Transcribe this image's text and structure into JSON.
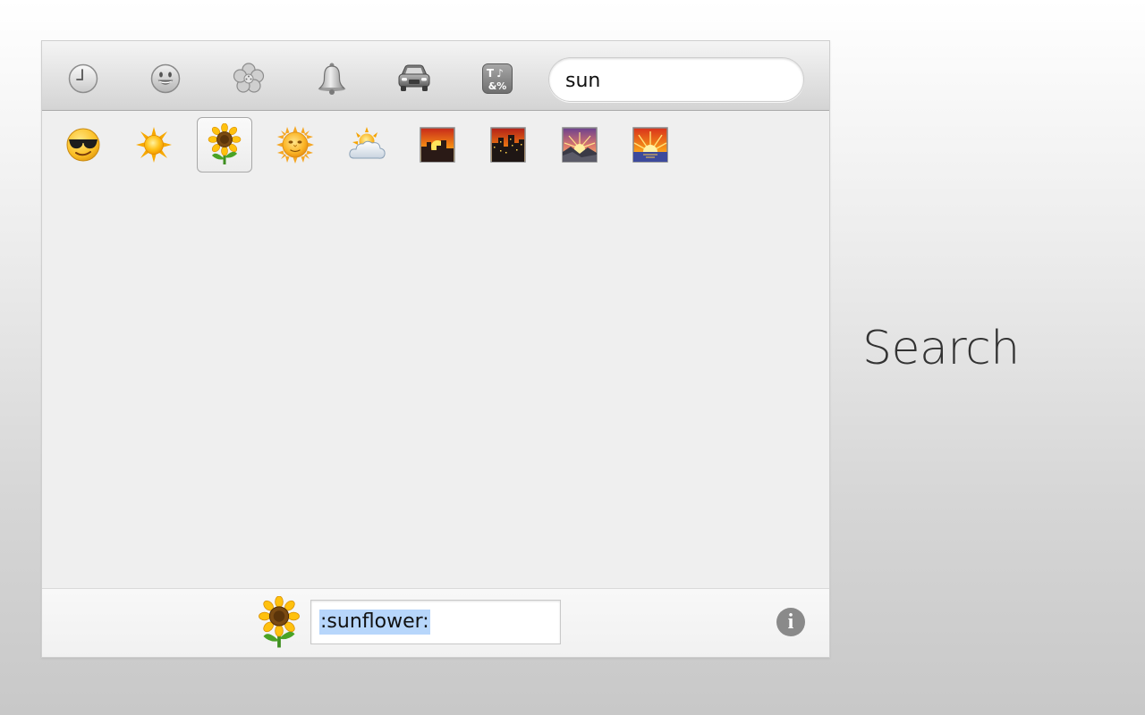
{
  "toolbar": {
    "tabs": [
      {
        "icon": "clock-icon",
        "name": "recent"
      },
      {
        "icon": "smiley-icon",
        "name": "people"
      },
      {
        "icon": "flower-icon",
        "name": "nature"
      },
      {
        "icon": "bell-icon",
        "name": "objects"
      },
      {
        "icon": "car-icon",
        "name": "places"
      },
      {
        "icon": "symbols-icon",
        "name": "symbols"
      }
    ],
    "search_value": "sun"
  },
  "results": [
    {
      "name": "sunglasses-face-emoji"
    },
    {
      "name": "sun-emoji"
    },
    {
      "name": "sunflower-emoji",
      "selected": true
    },
    {
      "name": "sun-face-emoji"
    },
    {
      "name": "sun-behind-cloud-emoji"
    },
    {
      "name": "city-sunset-emoji"
    },
    {
      "name": "city-dusk-emoji"
    },
    {
      "name": "sunrise-over-mountains-emoji"
    },
    {
      "name": "sunrise-emoji"
    }
  ],
  "footer": {
    "preview_icon": "sunflower-emoji",
    "shortcode": ":sunflower:",
    "info_label": "i"
  },
  "caption": "Search"
}
